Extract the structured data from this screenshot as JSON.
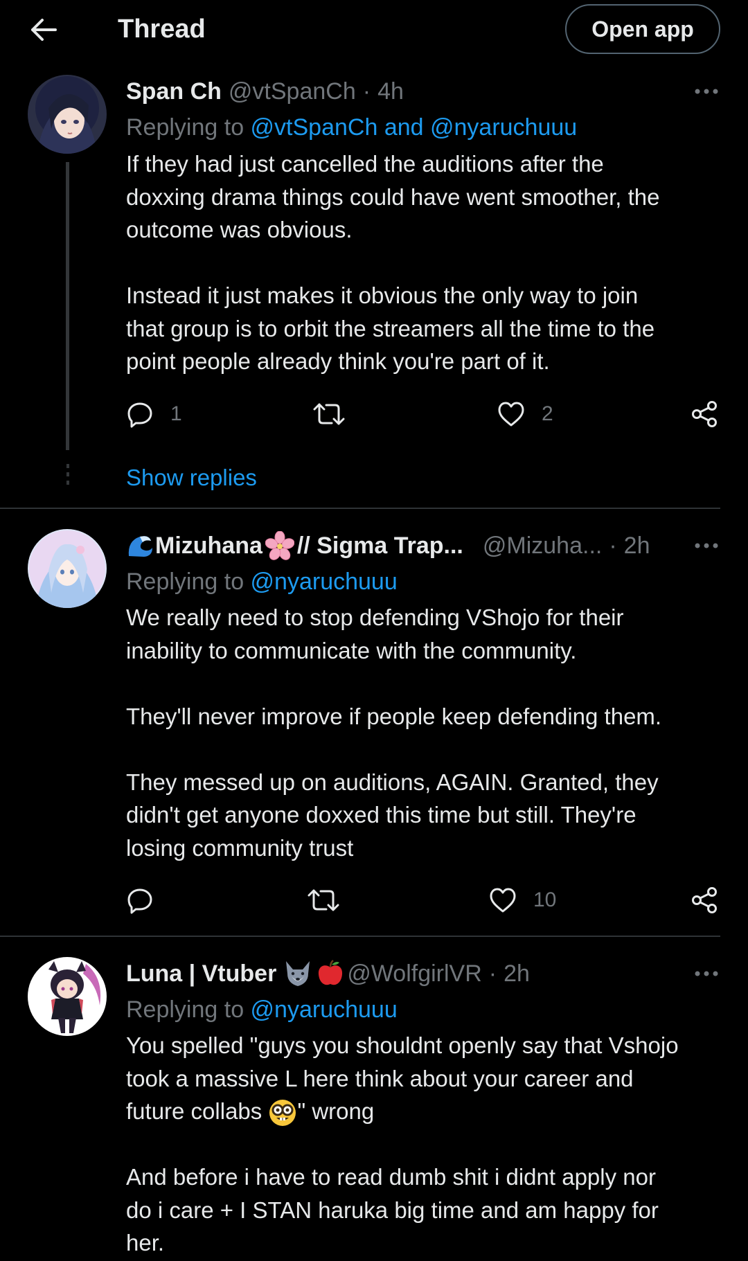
{
  "header": {
    "title": "Thread",
    "open_app_label": "Open app"
  },
  "tweets": [
    {
      "name": "Span Ch",
      "handle": "@vtSpanCh",
      "separator": "·",
      "time": "4h",
      "replying_prefix": "Replying to ",
      "replying_to": "@vtSpanCh and @nyaruchuuu",
      "paragraphs": [
        [
          "If they had just cancelled the auditions after the",
          "doxxing drama things could have went smoother, the",
          "outcome was obvious."
        ],
        [
          "Instead it just makes it obvious the only way to join",
          "that group is to orbit the streamers all the time to the",
          "point people already think you're part of it."
        ]
      ],
      "replies": "1",
      "retweets": "",
      "likes": "2",
      "show_replies": "Show replies"
    },
    {
      "name": "Mizuhana",
      "name_suffix": "// Sigma Trap...",
      "handle": "@Mizuha...",
      "separator": "·",
      "time": "2h",
      "replying_prefix": "Replying to ",
      "replying_to": "@nyaruchuuu",
      "paragraphs": [
        [
          "We really need to stop defending VShojo for their",
          "inability to communicate with the community."
        ],
        [
          "They'll never improve if people keep defending them."
        ],
        [
          "They messed up on auditions, AGAIN. Granted, they",
          "didn't get anyone doxxed this time but still. They're",
          "losing community trust"
        ]
      ],
      "replies": "",
      "retweets": "",
      "likes": "10"
    },
    {
      "name": "Luna | Vtuber",
      "handle": "@WolfgirlVR",
      "separator": "·",
      "time": "2h",
      "replying_prefix": "Replying to ",
      "replying_to": "@nyaruchuuu",
      "line1": "You spelled \"guys you shouldnt openly say that Vshojo",
      "line2": "took a massive L here think about your career and",
      "line3_a": "future collabs ",
      "line3_b": "\" wrong",
      "paragraph2": [
        "And before i have to read dumb shit i didnt apply nor",
        "do i care + I STAN haruka big time and am happy for",
        "her."
      ]
    }
  ],
  "colors": {
    "background": "#000000",
    "text": "#e7e9ea",
    "muted": "#71767b",
    "link": "#1d9bf0",
    "divider": "#2f3336"
  },
  "icons": [
    "back-arrow-icon",
    "more-icon",
    "reply-icon",
    "retweet-icon",
    "like-icon",
    "share-icon",
    "wave-icon",
    "flower-icon",
    "wolf-icon",
    "apple-icon",
    "nerd-face-icon"
  ]
}
